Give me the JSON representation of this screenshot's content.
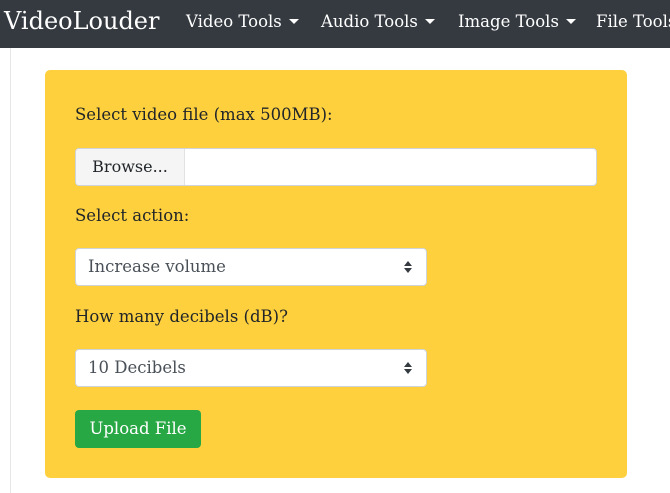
{
  "navbar": {
    "brand": "VideoLouder",
    "items": [
      {
        "label": "Video Tools",
        "has_dropdown": true
      },
      {
        "label": "Audio Tools",
        "has_dropdown": true
      },
      {
        "label": "Image Tools",
        "has_dropdown": true
      },
      {
        "label": "File Tools",
        "has_dropdown": false
      }
    ]
  },
  "form": {
    "file_label": "Select video file (max 500MB):",
    "browse_label": "Browse...",
    "file_value": "",
    "action_label": "Select action:",
    "action_value": "Increase volume",
    "decibels_label": "How many decibels (dB)?",
    "decibels_value": "10 Decibels",
    "upload_label": "Upload File"
  },
  "colors": {
    "navbar": "#343a40",
    "card": "#fed03e",
    "upload_button": "#28a745"
  },
  "icons": {
    "dropdown": "caret-down-icon",
    "select": "sort-icon"
  }
}
